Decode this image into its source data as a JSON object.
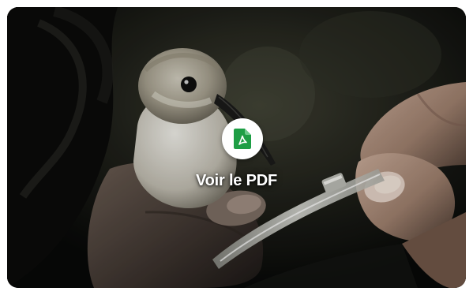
{
  "card": {
    "action_label": "Voir le PDF",
    "icon": "pdf-file-icon",
    "icon_color": "#1e9e45",
    "photo_subject": "bird-in-hand-image"
  }
}
